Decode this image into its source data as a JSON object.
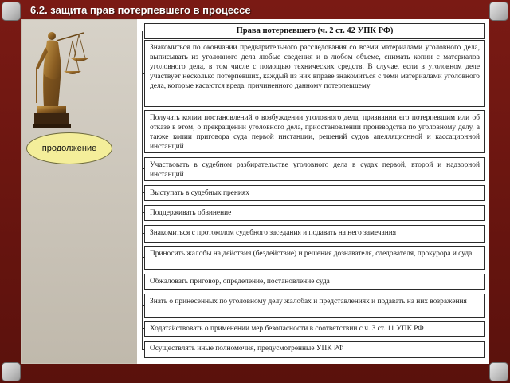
{
  "title": "6.2. защита прав потерпевшего в процессе",
  "side": {
    "continue_label": "продолжение"
  },
  "rights": {
    "header": "Права потерпевшего (ч. 2 ст. 42 УПК РФ)",
    "items": [
      "Знакомиться по окончании предварительного расследования со всеми материалами уголовного дела, выписывать из уголовного дела любые сведения и в любом объеме, снимать копии с материалов уголовного дела, в том числе с помощью технических средств. В случае, если в уголовном деле участвует несколько потерпевших, каждый из них вправе знакомиться с теми материалами уголовного дела, которые касаются вреда, причиненного данному потерпевшему",
      "Получать копии постановлений о возбуждении уголовного дела, признании его потерпевшим или об отказе в этом, о прекращении уголовного дела, приостановлении производства по уголовному делу, а также копии приговора суда первой инстанции, решений судов апелляционной и кассационной инстанций",
      "Участвовать в судебном разбирательстве уголовного дела в судах первой, второй и надзорной инстанций",
      "Выступать в судебных прениях",
      "Поддерживать обвинение",
      "Знакомиться с протоколом судебного заседания и подавать на него замечания",
      "Приносить жалобы на действия (бездействие) и решения дознавателя, следователя, прокурора и суда",
      "Обжаловать приговор, определение, постановление суда",
      "Знать о принесенных по уголовному делу жалобах и представлениях и подавать на них возражения",
      "Ходатайствовать о применении мер безопасности в соответствии с ч. 3 ст. 11 УПК РФ",
      "Осуществлять иные полномочия, предусмотренные УПК РФ"
    ]
  },
  "colors": {
    "frame": "#6b150f",
    "badge": "#f4ee9a",
    "panel": "#d7d2c8"
  }
}
